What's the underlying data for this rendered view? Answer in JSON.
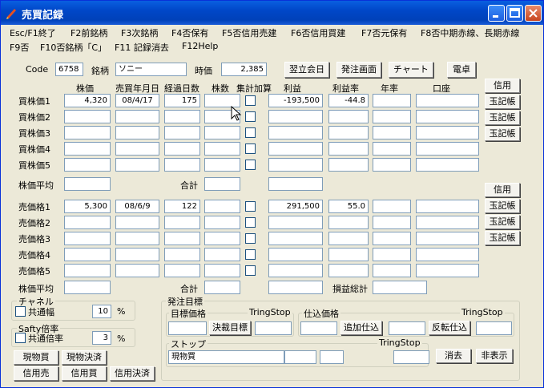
{
  "window": {
    "title": "売買記録"
  },
  "menu": [
    "Esc/F1終了",
    "F2前銘柄",
    "F3次銘柄",
    "F4否保有",
    "F5否信用売建",
    "F6否信用買建",
    "F7否元保有",
    "F8否中期赤線、長期赤線",
    "F9否",
    "F10否銘柄「C」",
    "F11 記録消去",
    "F12Help"
  ],
  "stock": {
    "code_label": "Code",
    "code": "6758",
    "name_label": "銘柄",
    "name": "ソニー",
    "price_label": "時価",
    "price": "2,385"
  },
  "top_buttons": [
    "翌立会日",
    "発注画面",
    "チャート",
    "電卓"
  ],
  "columns": [
    "株価",
    "売買年月日",
    "経過日数",
    "株数",
    "集計加算",
    "利益",
    "利益率",
    "年率",
    "口座"
  ],
  "buy_rows": [
    {
      "label": "買株価1",
      "price": "4,320",
      "date": "08/4/17",
      "days": "175",
      "shares": "",
      "profit": "-193,500",
      "rate": "-44.8"
    },
    {
      "label": "買株価2",
      "price": "",
      "date": "",
      "days": "",
      "shares": "",
      "profit": "",
      "rate": ""
    },
    {
      "label": "買株価3",
      "price": "",
      "date": "",
      "days": "",
      "shares": "",
      "profit": "",
      "rate": ""
    },
    {
      "label": "買株価4",
      "price": "",
      "date": "",
      "days": "",
      "shares": "",
      "profit": "",
      "rate": ""
    },
    {
      "label": "買株価5",
      "price": "",
      "date": "",
      "days": "",
      "shares": "",
      "profit": "",
      "rate": ""
    }
  ],
  "sell_rows": [
    {
      "label": "売価格1",
      "price": "5,300",
      "date": "08/6/9",
      "days": "122",
      "shares": "",
      "profit": "291,500",
      "rate": "55.0"
    },
    {
      "label": "売価格2",
      "price": "",
      "date": "",
      "days": "",
      "shares": "",
      "profit": "",
      "rate": ""
    },
    {
      "label": "売価格3",
      "price": "",
      "date": "",
      "days": "",
      "shares": "",
      "profit": "",
      "rate": ""
    },
    {
      "label": "売価格4",
      "price": "",
      "date": "",
      "days": "",
      "shares": "",
      "profit": "",
      "rate": ""
    },
    {
      "label": "売価格5",
      "price": "",
      "date": "",
      "days": "",
      "shares": "",
      "profit": "",
      "rate": ""
    }
  ],
  "avg_label": "株価平均",
  "total_label": "合計",
  "loss_total_label": "損益総計",
  "side_buttons": {
    "credit": "信用",
    "ledger": "玉記帳"
  },
  "channel": {
    "title": "チャネル",
    "check_label": "共通幅",
    "value": "10",
    "unit": "%"
  },
  "safety": {
    "title": "Safty倍率",
    "check_label": "共通倍率",
    "value": "3",
    "unit": "%"
  },
  "trade_buttons": [
    "現物買",
    "現物決済",
    "信用売",
    "信用買",
    "信用決済"
  ],
  "order": {
    "title": "発注目標",
    "target_label": "目標価格",
    "tring_stop": "TringStop",
    "decide_button": "決裁目標",
    "purchase_label": "仕込価格",
    "add_button": "追加仕込",
    "reverse_button": "反転仕込",
    "stop_label": "ストップ",
    "stop_field": "現物買",
    "clear_button": "消去",
    "hide_button": "非表示"
  }
}
